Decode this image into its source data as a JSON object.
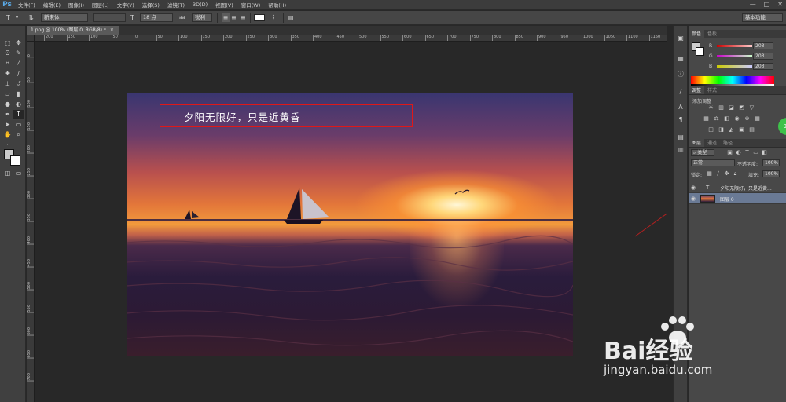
{
  "app": {
    "logo": "Ps"
  },
  "menu": [
    "文件(F)",
    "编辑(E)",
    "图像(I)",
    "图层(L)",
    "文字(Y)",
    "选择(S)",
    "滤镜(T)",
    "3D(D)",
    "视图(V)",
    "窗口(W)",
    "帮助(H)"
  ],
  "window_controls": [
    "—",
    "□",
    "✕"
  ],
  "options_bar": {
    "tool_glyph": "T",
    "font_family": "新宋体",
    "font_size": "18 点",
    "anti_alias": "锐利",
    "workspace": "基本功能"
  },
  "document": {
    "tab_label": "1.png @ 100% (图层 0, RGB/8) *"
  },
  "ruler": {
    "h_marks": [
      "200",
      "150",
      "100",
      "50",
      "0",
      "50",
      "100",
      "150",
      "200",
      "250",
      "300",
      "350",
      "400",
      "450",
      "500",
      "550",
      "600",
      "650",
      "700",
      "750",
      "800",
      "850",
      "900",
      "950",
      "1000",
      "1050",
      "1100",
      "1150"
    ],
    "v_marks": [
      "0",
      "50",
      "100",
      "150",
      "200",
      "250",
      "300",
      "350",
      "400",
      "450",
      "500",
      "550",
      "600",
      "650",
      "700"
    ]
  },
  "canvas": {
    "caption": "夕阳无限好，只是近黄昏"
  },
  "color_panel": {
    "tabs": [
      "颜色",
      "色板"
    ],
    "r_label": "R",
    "g_label": "G",
    "b_label": "B",
    "r": "203",
    "g": "203",
    "b": "203"
  },
  "adjust_panel": {
    "tabs": [
      "调整",
      "样式"
    ],
    "title": "添加调整"
  },
  "layers_panel": {
    "tabs": [
      "图层",
      "通道",
      "路径"
    ],
    "filter": "类型",
    "blend_mode": "正常",
    "opacity_label": "不透明度:",
    "opacity": "100%",
    "lock_label": "锁定:",
    "fill_label": "填充:",
    "fill": "100%",
    "layers": [
      {
        "name": "夕阳无限好，只是近黄...",
        "kind": "T"
      },
      {
        "name": "图层 0",
        "kind": "image"
      }
    ]
  },
  "float_button": {
    "label": "97"
  },
  "watermark": {
    "brand": "Bai经验",
    "url": "jingyan.baidu.com"
  },
  "colors": {
    "accent_red": "#e01818",
    "selected_layer": "#6a7a95"
  }
}
